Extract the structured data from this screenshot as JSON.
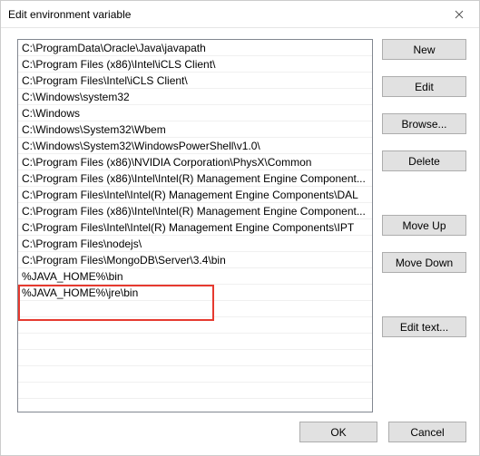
{
  "title": "Edit environment variable",
  "list_items": [
    "C:\\ProgramData\\Oracle\\Java\\javapath",
    "C:\\Program Files (x86)\\Intel\\iCLS Client\\",
    "C:\\Program Files\\Intel\\iCLS Client\\",
    "C:\\Windows\\system32",
    "C:\\Windows",
    "C:\\Windows\\System32\\Wbem",
    "C:\\Windows\\System32\\WindowsPowerShell\\v1.0\\",
    "C:\\Program Files (x86)\\NVIDIA Corporation\\PhysX\\Common",
    "C:\\Program Files (x86)\\Intel\\Intel(R) Management Engine Component...",
    "C:\\Program Files\\Intel\\Intel(R) Management Engine Components\\DAL",
    "C:\\Program Files (x86)\\Intel\\Intel(R) Management Engine Component...",
    "C:\\Program Files\\Intel\\Intel(R) Management Engine Components\\IPT",
    "C:\\Program Files\\nodejs\\",
    "C:\\Program Files\\MongoDB\\Server\\3.4\\bin",
    "%JAVA_HOME%\\bin",
    "%JAVA_HOME%\\jre\\bin"
  ],
  "buttons": {
    "new": "New",
    "edit": "Edit",
    "browse": "Browse...",
    "delete": "Delete",
    "move_up": "Move Up",
    "move_down": "Move Down",
    "edit_text": "Edit text...",
    "ok": "OK",
    "cancel": "Cancel"
  }
}
